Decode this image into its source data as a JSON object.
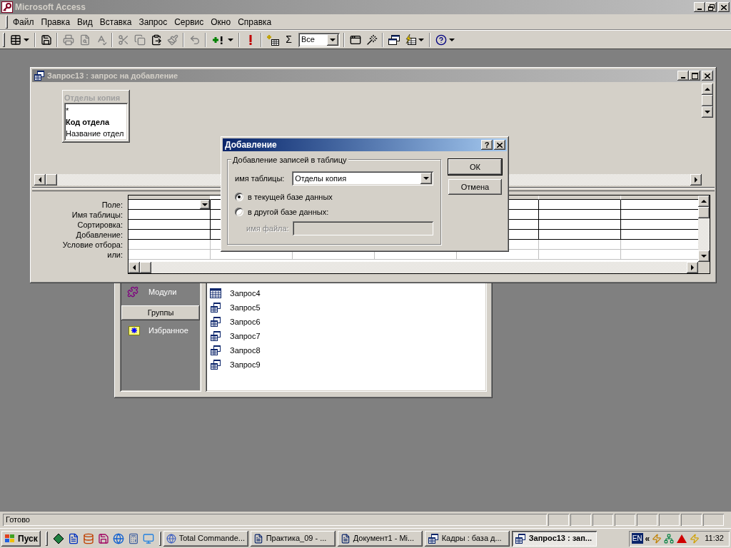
{
  "app_window": {
    "title": "Microsoft Access"
  },
  "menu": [
    "Файл",
    "Правка",
    "Вид",
    "Вставка",
    "Запрос",
    "Сервис",
    "Окно",
    "Справка"
  ],
  "toolbar": [
    {
      "kind": "view",
      "disabled": false,
      "dropdown": true
    },
    {
      "kind": "separator"
    },
    {
      "kind": "save",
      "disabled": false,
      "dropdown": false
    },
    {
      "kind": "separator"
    },
    {
      "kind": "print",
      "disabled": true,
      "dropdown": false
    },
    {
      "kind": "preview",
      "disabled": true,
      "dropdown": false
    },
    {
      "kind": "spelling",
      "disabled": true,
      "dropdown": false
    },
    {
      "kind": "separator"
    },
    {
      "kind": "cut",
      "disabled": true,
      "dropdown": false
    },
    {
      "kind": "copy",
      "disabled": true,
      "dropdown": false
    },
    {
      "kind": "paste",
      "disabled": false,
      "dropdown": false
    },
    {
      "kind": "painter",
      "disabled": true,
      "dropdown": false
    },
    {
      "kind": "separator"
    },
    {
      "kind": "undo",
      "disabled": true,
      "dropdown": false
    },
    {
      "kind": "separator"
    },
    {
      "kind": "query_type",
      "disabled": false,
      "dropdown": true
    },
    {
      "kind": "separator"
    },
    {
      "kind": "run",
      "disabled": false,
      "dropdown": false
    },
    {
      "kind": "separator"
    },
    {
      "kind": "show_table",
      "disabled": false,
      "dropdown": false
    },
    {
      "kind": "totals",
      "label": "Σ",
      "disabled": false,
      "dropdown": false
    },
    {
      "kind": "combo",
      "value": "Все"
    },
    {
      "kind": "separator"
    },
    {
      "kind": "properties",
      "disabled": false,
      "dropdown": false
    },
    {
      "kind": "build",
      "disabled": false,
      "dropdown": false
    },
    {
      "kind": "separator"
    },
    {
      "kind": "database_window",
      "disabled": false,
      "dropdown": false
    },
    {
      "kind": "new_object",
      "disabled": false,
      "dropdown": true
    },
    {
      "kind": "separator"
    },
    {
      "kind": "help",
      "disabled": false,
      "dropdown": true
    }
  ],
  "database_window": {
    "objects": [
      {
        "label": "Модули",
        "kind": "modules"
      }
    ],
    "groups_button": "Группы",
    "groups": [
      {
        "label": "Избранное",
        "kind": "favorites"
      }
    ],
    "items": [
      {
        "label": "Запрос4",
        "kind": "select"
      },
      {
        "label": "Запрос5",
        "kind": "append"
      },
      {
        "label": "Запрос6",
        "kind": "append"
      },
      {
        "label": "Запрос7",
        "kind": "append"
      },
      {
        "label": "Запрос8",
        "kind": "append"
      },
      {
        "label": "Запрос9",
        "kind": "append"
      }
    ]
  },
  "query_window": {
    "title": "Запрос13 : запрос на добавление",
    "field_list": {
      "title": "Отделы копия",
      "fields": [
        {
          "name": "*",
          "key": false
        },
        {
          "name": "Код отдела",
          "key": true
        },
        {
          "name": "Название отдел",
          "key": false
        }
      ]
    },
    "grid_rows": [
      "Поле:",
      "Имя таблицы:",
      "Сортировка:",
      "Добавление:",
      "Условие отбора:",
      "или:"
    ]
  },
  "dialog": {
    "title": "Добавление",
    "help_button": "?",
    "group_title": "Добавление записей в таблицу",
    "table_label": "имя таблицы:",
    "table_value": "Отделы копия",
    "options": [
      {
        "label": "в текущей базе данных",
        "selected": true
      },
      {
        "label": "в другой базе данных:",
        "selected": false
      }
    ],
    "file_field": {
      "label": "имя файла:",
      "disabled": true
    },
    "buttons": [
      "ОК",
      "Отмена"
    ]
  },
  "status_bar": {
    "text": "Готово"
  },
  "taskbar": {
    "start": "Пуск",
    "tasks": [
      {
        "label": "Total Commande...",
        "kind": "commander",
        "selected": false
      },
      {
        "label": "Практика_09 - ...",
        "kind": "word",
        "selected": false
      },
      {
        "label": "Документ1 - Mi...",
        "kind": "word",
        "selected": false
      },
      {
        "label": "Кадры : база д...",
        "kind": "database",
        "selected": false
      },
      {
        "label": "Запрос13 : зап...",
        "kind": "query",
        "selected": true
      }
    ],
    "language": "EN",
    "expand": "«",
    "clock": "11:32"
  }
}
